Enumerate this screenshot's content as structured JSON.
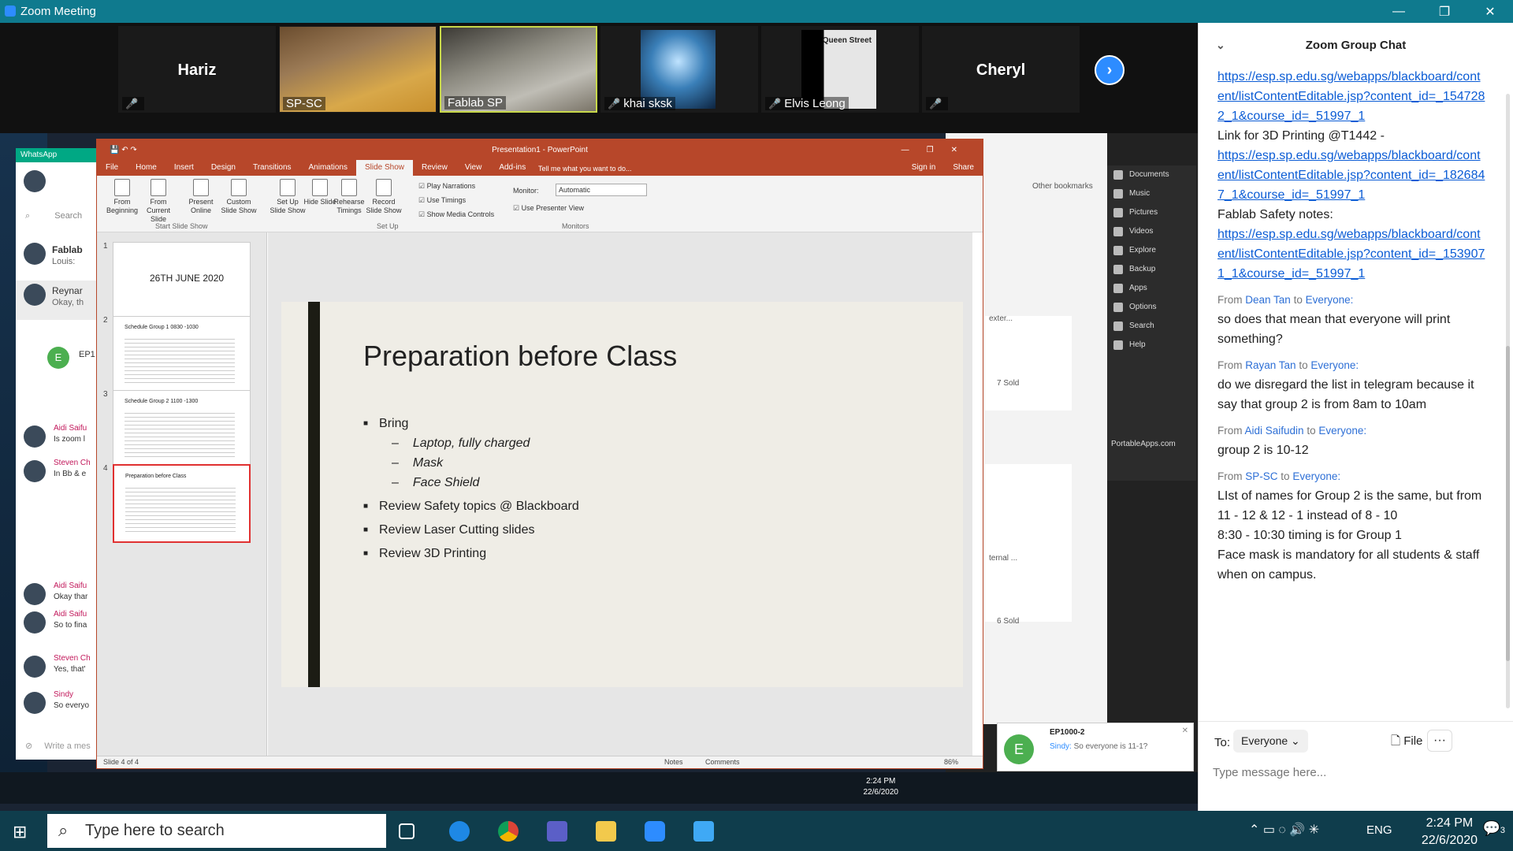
{
  "window": {
    "title": "Zoom Meeting"
  },
  "participants": [
    {
      "name": "Hariz",
      "muted": true
    },
    {
      "name": "SP-SC",
      "muted": false
    },
    {
      "name": "Fablab SP",
      "muted": false
    },
    {
      "name": "khai sksk",
      "muted": true
    },
    {
      "name": "Elvis Leong",
      "muted": true,
      "photo_text": "Queen Street"
    },
    {
      "name": "Cheryl",
      "muted": true
    }
  ],
  "ppt": {
    "title": "Presentation1 - PowerPoint",
    "menu": [
      "File",
      "Home",
      "Insert",
      "Design",
      "Transitions",
      "Animations",
      "Slide Show",
      "Review",
      "View",
      "Add-ins"
    ],
    "tell_me": "Tell me what you want to do...",
    "sign_in": "Sign in",
    "share": "Share",
    "ribbon": {
      "from_beginning": "From Beginning",
      "from_current": "From Current Slide",
      "present_online": "Present Online",
      "custom_show": "Custom Slide Show",
      "group_start": "Start Slide Show",
      "setup_show": "Set Up Slide Show",
      "hide_slide": "Hide Slide",
      "rehearse": "Rehearse Timings",
      "record": "Record Slide Show",
      "play_narrations": "Play Narrations",
      "use_timings": "Use Timings",
      "show_media": "Show Media Controls",
      "group_setup": "Set Up",
      "monitor_label": "Monitor:",
      "monitor_value": "Automatic",
      "presenter_view": "Use Presenter View",
      "group_monitors": "Monitors"
    },
    "thumbs": [
      {
        "num": "1",
        "text": "26TH JUNE 2020"
      },
      {
        "num": "2",
        "text": "Schedule Group 1 0830 -1030"
      },
      {
        "num": "3",
        "text": "Schedule Group 2 1100 -1300"
      },
      {
        "num": "4",
        "text": "Preparation before Class"
      }
    ],
    "slide": {
      "heading": "Preparation before Class",
      "bring": "Bring",
      "items": [
        "Laptop, fully charged",
        "Mask",
        "Face Shield"
      ],
      "bullets": [
        "Review Safety topics @ Blackboard",
        "Review Laser Cutting slides",
        "Review 3D Printing"
      ]
    },
    "status": {
      "slide": "Slide 4 of 4",
      "notes": "Notes",
      "comments": "Comments",
      "zoom": "86%"
    }
  },
  "whatsapp": {
    "title": "WhatsApp",
    "search": "Search",
    "chats": [
      {
        "name": "Fablab",
        "preview": "Louis:"
      },
      {
        "name": "Reynar",
        "preview": "Okay, th"
      }
    ],
    "group": "EP1",
    "messages": [
      {
        "sender": "Aidi Saifu",
        "text": "Is zoom l"
      },
      {
        "sender": "Steven Ch",
        "text": "In Bb & e"
      },
      {
        "sender": "Aidi Saifu",
        "text": "Okay thar"
      },
      {
        "sender": "Aidi Saifu",
        "text": "So to fina"
      },
      {
        "sender": "Steven Ch",
        "text": "Yes, that'"
      },
      {
        "sender": "Sindy",
        "text": "So everyo"
      }
    ],
    "compose": "Write a mes"
  },
  "portableapps": {
    "items": [
      "Documents",
      "Music",
      "Pictures",
      "Videos",
      "Explore",
      "Backup",
      "Apps",
      "Options",
      "Search",
      "Help"
    ],
    "brand": "PortableApps.com"
  },
  "browser": {
    "bookmarks": "Other bookmarks",
    "sold1": "7 Sold",
    "sold2": "6 Sold",
    "ext1": "exter...",
    "ext2": "ternal ..."
  },
  "notification": {
    "group": "EP1000-2",
    "sender": "Sindy:",
    "text": "So everyone is 11-1?",
    "avatar": "E"
  },
  "inner_clock": {
    "time": "2:24 PM",
    "date": "22/6/2020"
  },
  "chat": {
    "title": "Zoom Group Chat",
    "top_links": [
      "https://esp.sp.edu.sg/webapps/blackboard/content/listContentEditable.jsp?content_id=_1547282_1&course_id=_51997_1"
    ],
    "link_label_1": "Link for 3D Printing @T1442 -",
    "link_1": "https://esp.sp.edu.sg/webapps/blackboard/content/listContentEditable.jsp?content_id=_1826847_1&course_id=_51997_1",
    "link_label_2": "Fablab Safety notes:",
    "link_2": "https://esp.sp.edu.sg/webapps/blackboard/content/listContentEditable.jsp?content_id=_1539071_1&course_id=_51997_1",
    "messages": [
      {
        "from": "Dean Tan",
        "to": "Everyone:",
        "text": "so does that mean that everyone will print something?"
      },
      {
        "from": "Rayan Tan",
        "to": "Everyone:",
        "text": "do we disregard the list in telegram because it say that group 2 is from 8am to 10am"
      },
      {
        "from": "Aidi Saifudin",
        "to": "Everyone:",
        "text": "group 2 is 10-12"
      },
      {
        "from": "SP-SC",
        "to": "Everyone:",
        "lines": [
          "LIst of names for Group 2 is the same, but from 11 - 12 & 12 - 1 instead of 8 - 10",
          "8:30 - 10:30 timing is for Group 1",
          "Face mask is mandatory for all students & staff when on campus."
        ]
      }
    ],
    "from_word": "From",
    "to_word": "to",
    "to_label": "To:",
    "to_value": "Everyone",
    "file_label": "File",
    "more": "···",
    "placeholder": "Type message here..."
  },
  "taskbar": {
    "search": "Type here to search",
    "lang": "ENG",
    "time": "2:24 PM",
    "date": "22/6/2020",
    "notif_count": "3"
  },
  "colors": {
    "zoom_bar": "#0f7a8e",
    "ppt_red": "#b7472a",
    "link": "#0b5cd5",
    "taskbar": "#0f3d4c"
  }
}
